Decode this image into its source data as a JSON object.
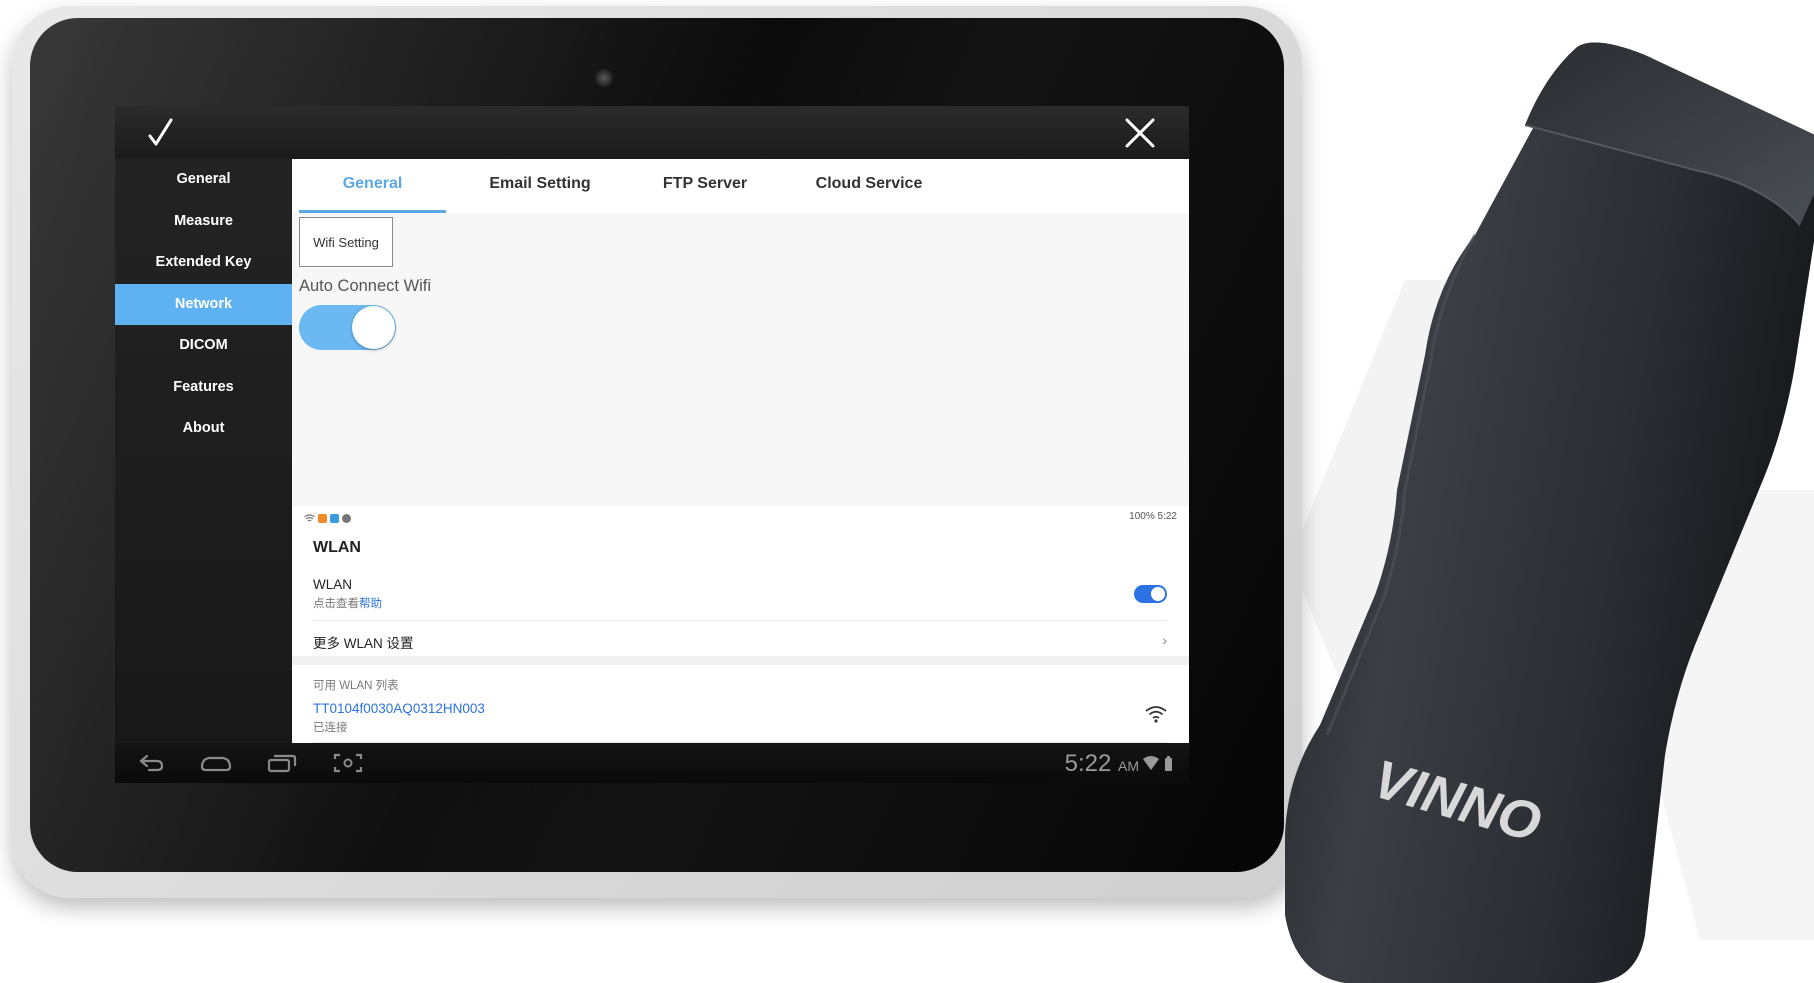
{
  "sidebar": {
    "items": [
      {
        "label": "General"
      },
      {
        "label": "Measure"
      },
      {
        "label": "Extended Key"
      },
      {
        "label": "Network",
        "active": true
      },
      {
        "label": "DICOM"
      },
      {
        "label": "Features"
      },
      {
        "label": "About"
      }
    ]
  },
  "tabs": [
    {
      "label": "General",
      "active": true
    },
    {
      "label": "Email Setting"
    },
    {
      "label": "FTP Server"
    },
    {
      "label": "Cloud Service"
    }
  ],
  "network_general": {
    "wifi_setting_button": "Wifi Setting",
    "auto_connect_label": "Auto Connect Wifi",
    "auto_connect_on": true
  },
  "phone_wlan": {
    "status_right": "100%  5:22",
    "title": "WLAN",
    "wlan_label": "WLAN",
    "wlan_sub_prefix": "点击查看",
    "wlan_sub_link": "帮助",
    "wlan_on": true,
    "more_settings": "更多 WLAN 设置",
    "available_list_label": "可用 WLAN 列表",
    "network_name": "TT0104f0030AQ0312HN003",
    "network_status": "已连接"
  },
  "navbar": {
    "time": "5:22",
    "ampm": "AM"
  },
  "device": {
    "brand": "VINNO"
  },
  "colors": {
    "accent": "#5fb2f2",
    "link_blue": "#2b73e3"
  }
}
